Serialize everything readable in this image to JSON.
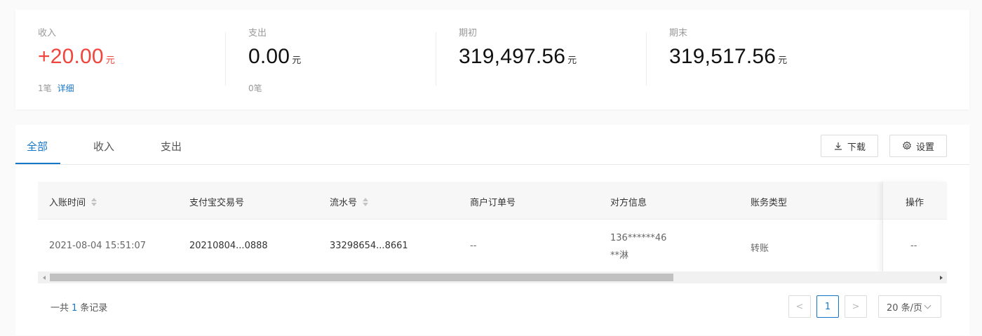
{
  "summary": {
    "income": {
      "label": "收入",
      "value": "+20.00",
      "unit": "元",
      "count": "1笔",
      "detail_link": "详细"
    },
    "expense": {
      "label": "支出",
      "value": "0.00",
      "unit": "元",
      "count": "0笔"
    },
    "opening": {
      "label": "期初",
      "value": "319,497.56",
      "unit": "元"
    },
    "closing": {
      "label": "期末",
      "value": "319,517.56",
      "unit": "元"
    }
  },
  "tabs": [
    {
      "label": "全部",
      "active": true
    },
    {
      "label": "收入",
      "active": false
    },
    {
      "label": "支出",
      "active": false
    }
  ],
  "toolbar": {
    "download_label": "下载",
    "settings_label": "设置"
  },
  "table": {
    "columns": [
      "入账时间",
      "支付宝交易号",
      "流水号",
      "商户订单号",
      "对方信息",
      "账务类型",
      "操作"
    ],
    "rows": [
      {
        "time": "2021-08-04 15:51:07",
        "alipay_trade_no": "20210804...0888",
        "serial_no": "33298654...8661",
        "merchant_order_no": "--",
        "counterparty_line1": "136******46",
        "counterparty_line2": "**淋",
        "type": "转账",
        "action": "--"
      }
    ]
  },
  "pagination": {
    "total_prefix": "一共",
    "total_count": "1",
    "total_suffix": "条记录",
    "prev": "<",
    "current_page": "1",
    "next": ">",
    "page_size": "20 条/页"
  },
  "colors": {
    "accent": "#1677c9",
    "positive": "#f0453c"
  }
}
